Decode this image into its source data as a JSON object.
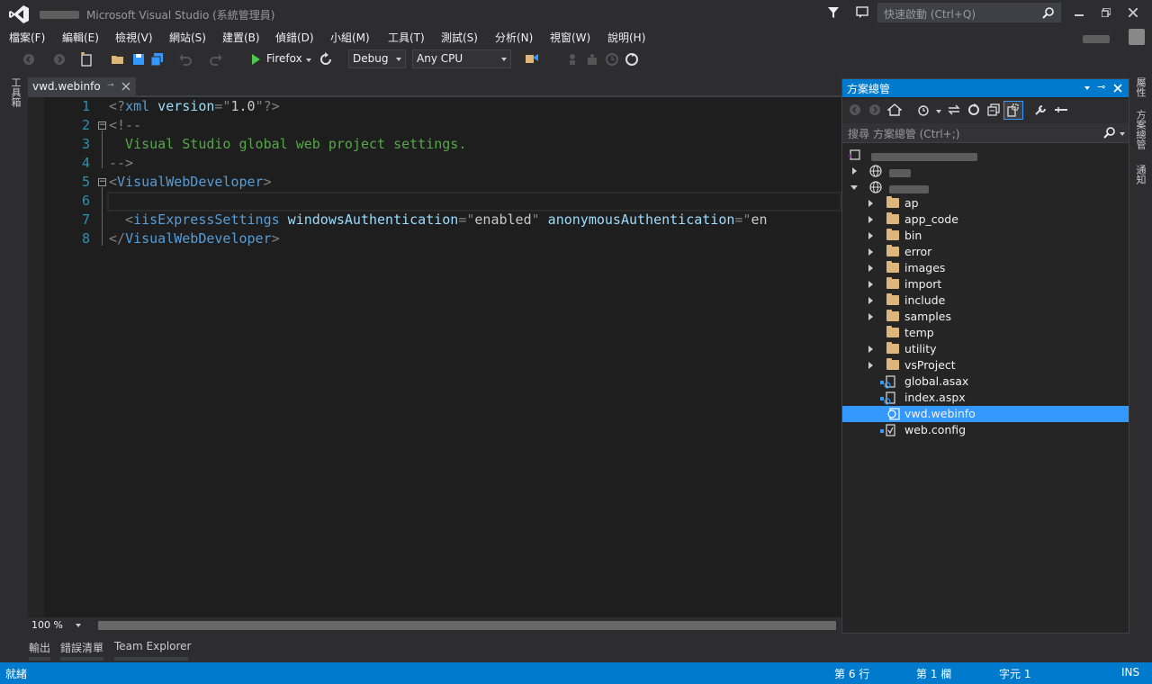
{
  "window": {
    "title": "Microsoft Visual Studio (系統管理員)",
    "quick_launch_placeholder": "快速啟動 (Ctrl+Q)"
  },
  "menu": {
    "items": [
      "檔案(F)",
      "編輯(E)",
      "檢視(V)",
      "網站(S)",
      "建置(B)",
      "偵錯(D)",
      "小組(M)",
      "工具(T)",
      "測試(S)",
      "分析(N)",
      "視窗(W)",
      "說明(H)"
    ]
  },
  "toolbar": {
    "run_target": "Firefox",
    "configuration": "Debug",
    "platform": "Any CPU"
  },
  "left_tab": {
    "label": "工具箱"
  },
  "document": {
    "tab_label": "vwd.webinfo",
    "line_numbers": [
      "1",
      "2",
      "3",
      "4",
      "5",
      "6",
      "7",
      "8"
    ],
    "lines": {
      "l1_a": "<?",
      "l1_b": "xml",
      "l1_c": " version",
      "l1_d": "=\"",
      "l1_e": "1.0",
      "l1_f": "\"?>",
      "l2": "<!--",
      "l3": "  Visual Studio global web project settings.",
      "l4": "-->",
      "l5_a": "<",
      "l5_b": "VisualWebDeveloper",
      "l5_c": ">",
      "l7_a": "  <",
      "l7_b": "iisExpressSettings",
      "l7_c": " windowsAuthentication",
      "l7_d": "=\"",
      "l7_e": "enabled",
      "l7_f": "\"",
      "l7_g": " anonymousAuthentication",
      "l7_h": "=\"",
      "l7_i": "en",
      "l8_a": "</",
      "l8_b": "VisualWebDeveloper",
      "l8_c": ">"
    },
    "zoom": "100 %"
  },
  "bottom_tabs": [
    "輸出",
    "錯誤清單",
    "Team Explorer"
  ],
  "status": {
    "ready": "就緒",
    "line": "第 6 行",
    "column": "第 1 欄",
    "char": "字元 1",
    "mode": "INS"
  },
  "solution_explorer": {
    "title": "方案總管",
    "search_placeholder": "搜尋 方案總管 (Ctrl+;)",
    "folders": [
      "ap",
      "app_code",
      "bin",
      "error",
      "images",
      "import",
      "include",
      "samples",
      "temp",
      "utility",
      "vsProject"
    ],
    "files": [
      "global.asax",
      "index.aspx",
      "vwd.webinfo",
      "web.config"
    ],
    "selected": "vwd.webinfo"
  },
  "right_tabs": [
    "屬性",
    "方案總管",
    "通知"
  ],
  "colors": {
    "accent": "#007acc",
    "selection": "#3399ff",
    "editor_bg": "#1e1e1e",
    "chrome_bg": "#2d2d30"
  }
}
